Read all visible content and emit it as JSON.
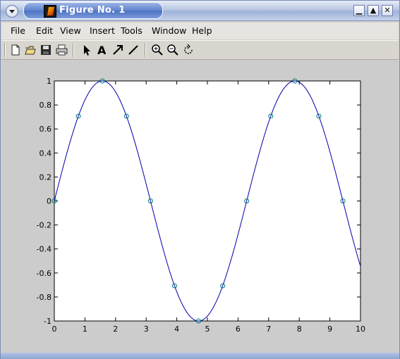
{
  "window": {
    "title": "Figure No. 1",
    "buttons": {
      "minimize": "▁",
      "maximize": "▲",
      "close": "✕"
    }
  },
  "menu": {
    "items": [
      "File",
      "Edit",
      "View",
      "Insert",
      "Tools",
      "Window",
      "Help"
    ]
  },
  "toolbar": {
    "icons": [
      "new-file-icon",
      "open-folder-icon",
      "save-icon",
      "print-icon",
      "select-arrow-icon",
      "text-insert-icon",
      "arrow-insert-icon",
      "line-insert-icon",
      "zoom-in-icon",
      "zoom-out-icon",
      "rotate-icon"
    ]
  },
  "chart_data": {
    "type": "line",
    "title": "",
    "xlabel": "",
    "ylabel": "",
    "xlim": [
      0,
      10
    ],
    "ylim": [
      -1,
      1
    ],
    "xticks": [
      0,
      1,
      2,
      3,
      4,
      5,
      6,
      7,
      8,
      9,
      10
    ],
    "yticks": [
      -1,
      -0.8,
      -0.6,
      -0.4,
      -0.2,
      0,
      0.2,
      0.4,
      0.6,
      0.8,
      1
    ],
    "grid": false,
    "series": [
      {
        "function": "sin(x)",
        "style": "solid line",
        "color": "#0000aa",
        "x_range": [
          0,
          10
        ]
      },
      {
        "style": "circle markers",
        "color": "#007a7a",
        "x": [
          0,
          0.785,
          1.571,
          2.356,
          3.142,
          3.927,
          4.712,
          5.498,
          6.283,
          7.069,
          7.854,
          8.639,
          9.425
        ],
        "y": [
          0,
          0.707,
          1,
          0.707,
          0,
          -0.707,
          -1,
          -0.707,
          0,
          0.707,
          1,
          0.707,
          0
        ]
      }
    ]
  }
}
